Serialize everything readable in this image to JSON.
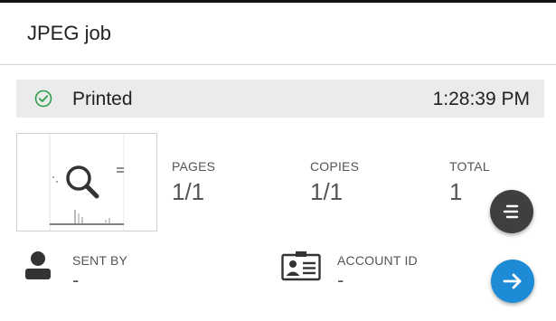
{
  "job": {
    "title": "JPEG job"
  },
  "status": {
    "text": "Printed",
    "time": "1:28:39 PM",
    "icon": "check-circle-icon",
    "color": "#2e9e4a"
  },
  "stats": {
    "pages": {
      "label": "PAGES",
      "value": "1/1"
    },
    "copies": {
      "label": "COPIES",
      "value": "1/1"
    },
    "total": {
      "label": "TOTAL",
      "value": "1"
    }
  },
  "sent_by": {
    "label": "SENT BY",
    "value": "-",
    "icon": "person-icon"
  },
  "account_id": {
    "label": "ACCOUNT ID",
    "value": "-",
    "icon": "id-card-icon"
  },
  "actions": {
    "menu": {
      "icon": "list-menu-icon",
      "color": "#3f3f3f"
    },
    "next": {
      "icon": "arrow-right-icon",
      "color": "#1e8bd6"
    }
  },
  "thumbnail": {
    "icon": "magnifier-icon"
  }
}
